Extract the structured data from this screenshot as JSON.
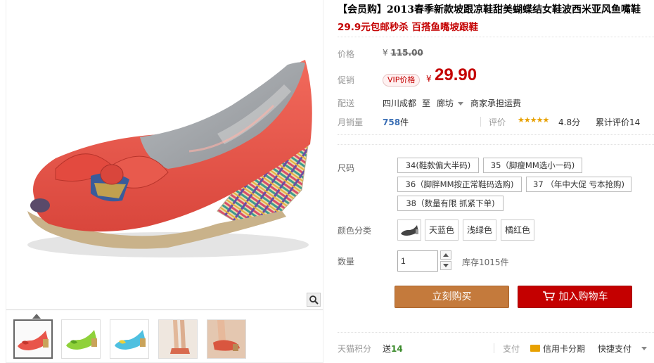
{
  "product": {
    "title": "【会员购】2013春季新款坡跟凉鞋甜美蝴蝶结女鞋波西米亚风鱼嘴鞋",
    "subtitle": "29.9元包邮秒杀 百搭鱼嘴坡跟鞋"
  },
  "price": {
    "label": "价格",
    "currency": "¥",
    "original": "115.00"
  },
  "promo": {
    "label": "促销",
    "vip_tag": "VIP价格",
    "currency": "¥",
    "price": "29.90"
  },
  "shipping": {
    "label": "配送",
    "from": "四川成都",
    "to_word": "至",
    "destination": "廊坊",
    "fee": "商家承担运费"
  },
  "sales": {
    "label": "月销量",
    "count": "758",
    "unit": "件",
    "review_label": "评价",
    "stars": "★★★★★",
    "score": "4.8分",
    "cumulative": "累计评价14"
  },
  "options": {
    "size_label": "尺码",
    "sizes": [
      "34(鞋款偏大半码)",
      "35（脚瘦MM选小一码)",
      "36（脚胖MM按正常鞋码选购)",
      "37 （年中大促 亏本抢购)",
      "38（数量有限 抓紧下单)"
    ],
    "color_label": "颜色分类",
    "colors": [
      "天蓝色",
      "浅绿色",
      "橘红色"
    ]
  },
  "quantity": {
    "label": "数量",
    "value": "1",
    "stock": "库存1015件"
  },
  "actions": {
    "buy": "立刻购买",
    "cart": "加入购物车"
  },
  "footer": {
    "points_label": "天猫积分",
    "points_prefix": "送",
    "points": "14",
    "pay_label": "支付",
    "credit": "信用卡分期",
    "quick": "快捷支付"
  },
  "colors": {
    "accent_red": "#c40000",
    "buy_brown": "#c47a3c",
    "shoe_coral": "#e8554a"
  }
}
